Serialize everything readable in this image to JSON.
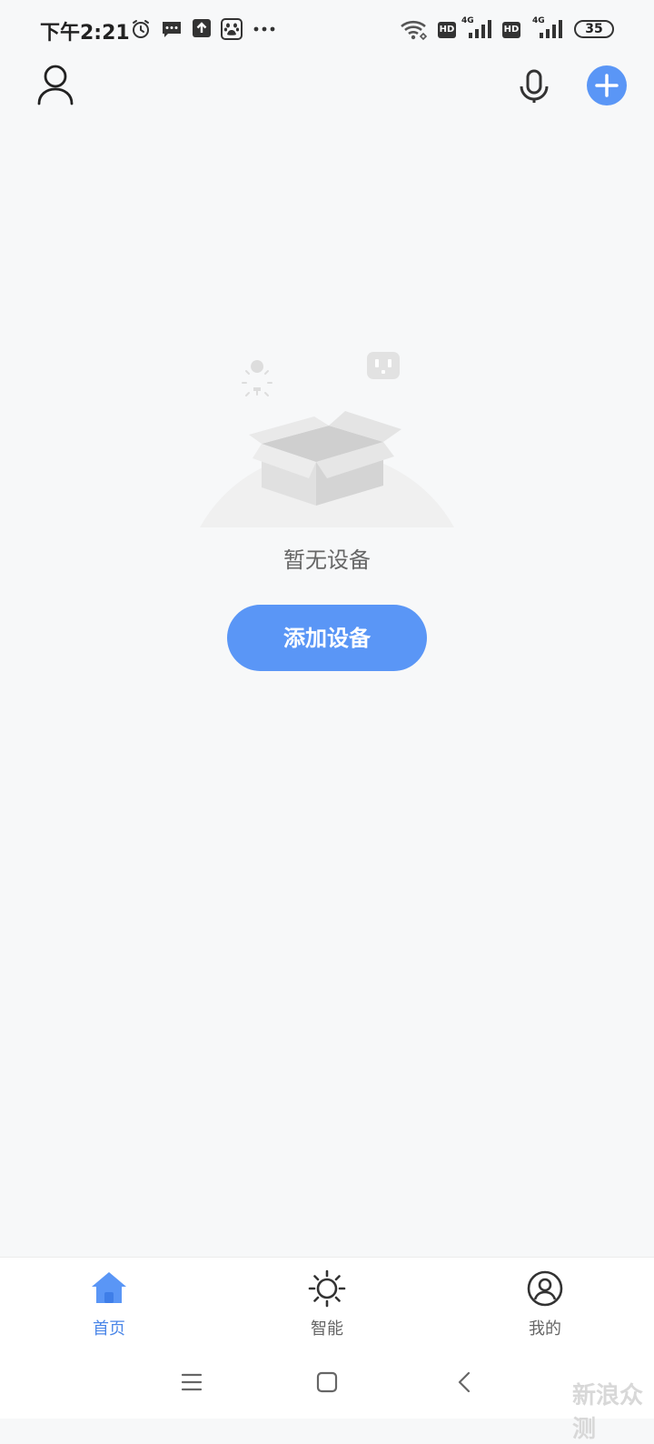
{
  "status_bar": {
    "time": "下午2:21",
    "icons": [
      "alarm-icon",
      "message-icon",
      "upload-icon",
      "baidu-paw-icon",
      "more-dots-icon",
      "wifi-icon",
      "hd-icon",
      "signal-4g-icon",
      "hd-icon",
      "signal-4g-icon",
      "battery-icon"
    ],
    "hd_label": "HD",
    "network_label": "4G",
    "battery_level": "35"
  },
  "header": {
    "left_icon": "user-icon",
    "right_icons": [
      "microphone-icon",
      "add-icon"
    ]
  },
  "empty_state": {
    "illustration": "empty-box-illustration",
    "message": "暂无设备",
    "button_label": "添加设备"
  },
  "bottom_nav": {
    "items": [
      {
        "label": "首页",
        "icon": "home-icon",
        "active": true
      },
      {
        "label": "智能",
        "icon": "sun-icon",
        "active": false
      },
      {
        "label": "我的",
        "icon": "profile-icon",
        "active": false
      }
    ]
  },
  "system_nav": {
    "buttons": [
      "menu-icon",
      "home-square-icon",
      "back-icon"
    ]
  },
  "watermark": "新浪众测",
  "colors": {
    "accent": "#5a96f6",
    "background": "#f7f8f9",
    "active_text": "#4a86e8"
  }
}
